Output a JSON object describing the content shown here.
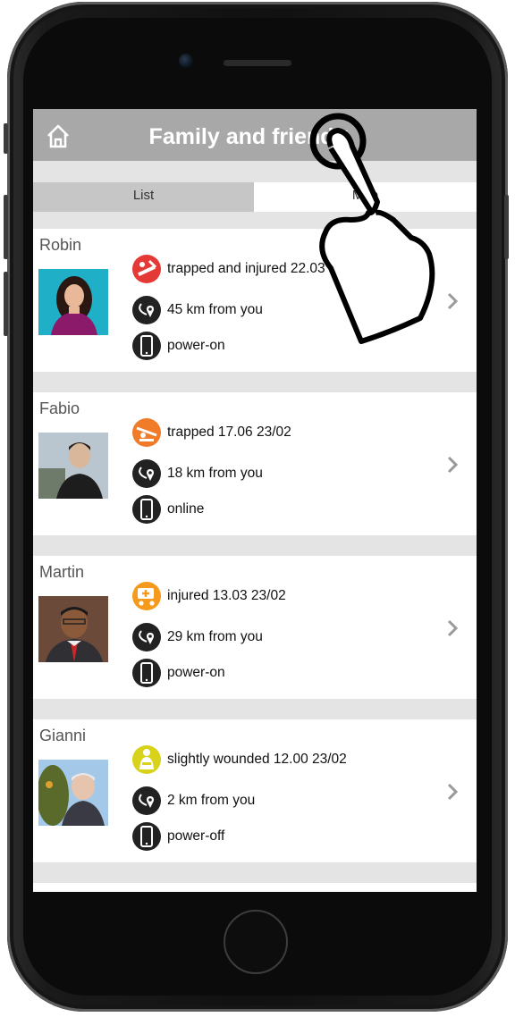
{
  "header": {
    "title": "Family and friends"
  },
  "tabs": [
    {
      "label": "List"
    },
    {
      "label": "Map"
    }
  ],
  "contacts": [
    {
      "name": "Robin",
      "status": "trapped and injured 22.03 23/02",
      "distance": "45 km from you",
      "device": "power-on",
      "status_icon": "trapped-injured-icon",
      "status_color": "#e53935"
    },
    {
      "name": "Fabio",
      "status": "trapped 17.06 23/02",
      "distance": "18 km from you",
      "device": "online",
      "status_icon": "trapped-icon",
      "status_color": "#f07c2a"
    },
    {
      "name": "Martin",
      "status": "injured 13.03 23/02",
      "distance": "29 km from you",
      "device": "power-on",
      "status_icon": "injured-icon",
      "status_color": "#f59a1c"
    },
    {
      "name": "Gianni",
      "status": "slightly wounded 12.00 23/02",
      "distance": "2 km from you",
      "device": "power-off",
      "status_icon": "slightly-wounded-icon",
      "status_color": "#d8d21a"
    }
  ]
}
